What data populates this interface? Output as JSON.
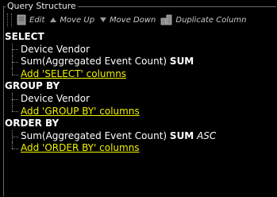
{
  "panel": {
    "title": "Query Structure"
  },
  "toolbar": {
    "edit_label": "Edit",
    "move_up_label": "Move Up",
    "move_down_label": "Move Down",
    "duplicate_label": "Duplicate Column"
  },
  "tree": {
    "select": {
      "header": "SELECT",
      "items": [
        {
          "text": "Device Vendor"
        },
        {
          "text": "Sum(Aggregated Event Count)",
          "func": "SUM"
        }
      ],
      "add_link": "Add 'SELECT' columns"
    },
    "group_by": {
      "header": "GROUP BY",
      "items": [
        {
          "text": "Device Vendor"
        }
      ],
      "add_link": "Add 'GROUP BY' columns"
    },
    "order_by": {
      "header": "ORDER BY",
      "items": [
        {
          "text": "Sum(Aggregated Event Count)",
          "func": "SUM",
          "order": "ASC"
        }
      ],
      "add_link": "Add 'ORDER BY' columns"
    }
  },
  "colors": {
    "background": "#000000",
    "link": "#f1f100",
    "text": "#ffffff"
  },
  "icons": [
    "edit-icon",
    "move-up-icon",
    "move-down-icon",
    "duplicate-icon"
  ]
}
